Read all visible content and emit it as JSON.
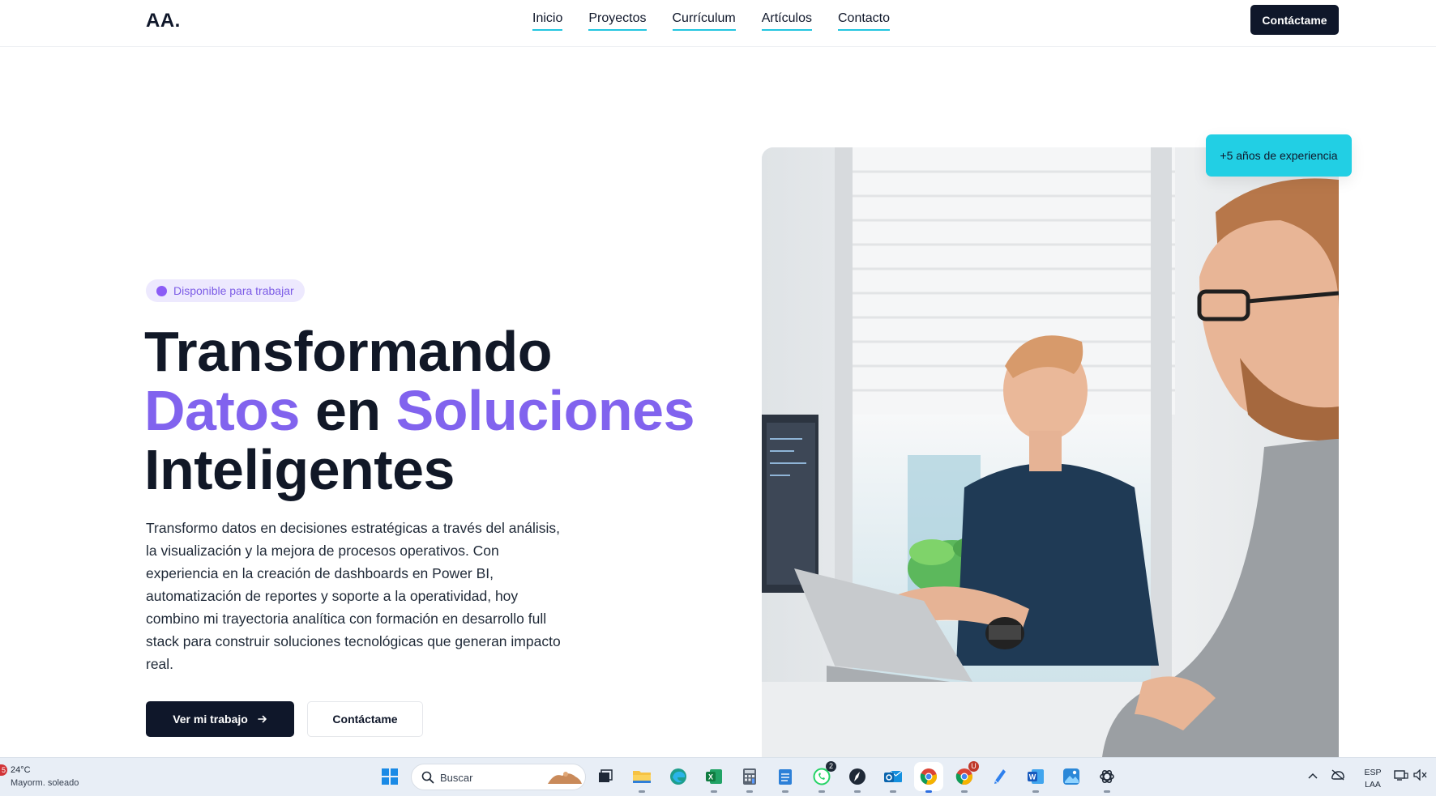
{
  "nav": {
    "logo": "AA.",
    "links": [
      "Inicio",
      "Proyectos",
      "Currículum",
      "Artículos",
      "Contacto"
    ],
    "cta": "Contáctame"
  },
  "hero": {
    "badge": "Disponible para trabajar",
    "headline": {
      "line1": "Transformando",
      "word_accent_1": "Datos",
      "word_plain": "en",
      "word_accent_2": "Soluciones",
      "line3": "Inteligentes"
    },
    "intro": "Transformo datos en decisiones estratégicas a través del análisis, la visualización y la mejora de procesos operativos. Con experiencia en la creación de dashboards en Power BI, automatización de reportes y soporte a la operatividad, hoy combino mi trayectoria analítica con formación en desarrollo full stack para construir soluciones tecnológicas que generan impacto real.",
    "primary_button": "Ver mi trabajo",
    "secondary_button": "Contáctame",
    "experience_pill": "+5 años de experiencia"
  },
  "colors": {
    "accent_purple": "#8163ee",
    "accent_cyan": "#22cfe4",
    "dark": "#0f172a"
  },
  "taskbar": {
    "weather_badge": "5",
    "weather_temp": "24°C",
    "weather_desc": "Mayorm. soleado",
    "search_placeholder": "Buscar",
    "whatsapp_count": "2",
    "chrome_count": "U",
    "lang_top": "ESP",
    "lang_bottom": "LAA",
    "icons": [
      "windows-start-icon",
      "task-view-icon",
      "file-explorer-icon",
      "edge-icon",
      "excel-icon",
      "calculator-icon",
      "notepad-icon",
      "whatsapp-icon",
      "compass-app-icon",
      "outlook-icon",
      "chrome-icon",
      "chrome-profile-icon",
      "pen-app-icon",
      "word-icon",
      "photos-icon",
      "chatgpt-icon"
    ]
  }
}
